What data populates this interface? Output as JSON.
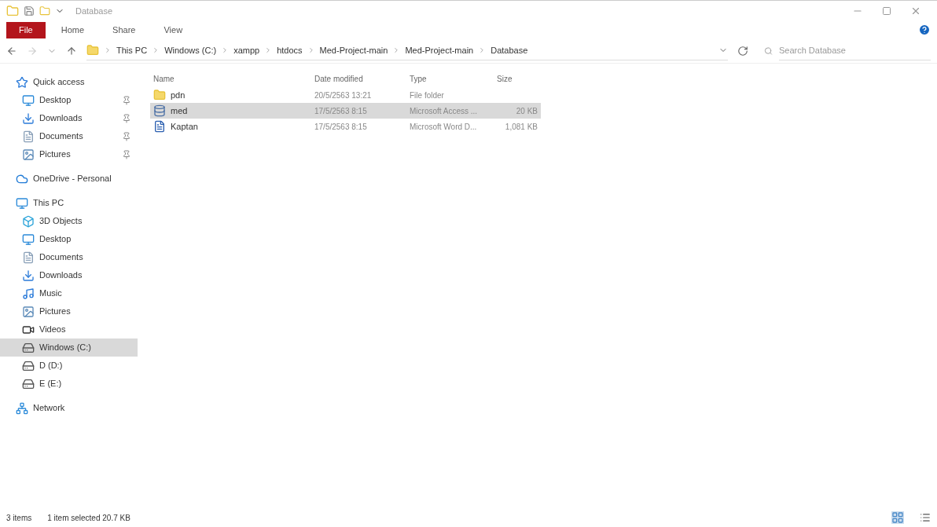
{
  "window": {
    "title": "Database"
  },
  "ribbon_tabs": [
    {
      "label": "File",
      "selected": true
    },
    {
      "label": "Home",
      "selected": false
    },
    {
      "label": "Share",
      "selected": false
    },
    {
      "label": "View",
      "selected": false
    }
  ],
  "breadcrumb": [
    "This PC",
    "Windows (C:)",
    "xampp",
    "htdocs",
    "Med-Project-main",
    "Med-Project-main",
    "Database"
  ],
  "search": {
    "placeholder": "Search Database"
  },
  "sidebar": [
    {
      "label": "Quick access",
      "selected": false,
      "children": [
        {
          "label": "Desktop",
          "selected": false,
          "pinned": true
        },
        {
          "label": "Downloads",
          "selected": false,
          "pinned": true
        },
        {
          "label": "Documents",
          "selected": false,
          "pinned": true
        },
        {
          "label": "Pictures",
          "selected": false,
          "pinned": true
        }
      ]
    },
    {
      "label": "OneDrive - Personal",
      "selected": false
    },
    {
      "label": "This PC",
      "selected": false,
      "children": [
        {
          "label": "3D Objects",
          "selected": false,
          "pinned": false
        },
        {
          "label": "Desktop",
          "selected": false,
          "pinned": false
        },
        {
          "label": "Documents",
          "selected": false,
          "pinned": false
        },
        {
          "label": "Downloads",
          "selected": false,
          "pinned": false
        },
        {
          "label": "Music",
          "selected": false,
          "pinned": false
        },
        {
          "label": "Pictures",
          "selected": false,
          "pinned": false
        },
        {
          "label": "Videos",
          "selected": false,
          "pinned": false
        },
        {
          "label": "Windows (C:)",
          "selected": true,
          "pinned": false
        },
        {
          "label": "D (D:)",
          "selected": false,
          "pinned": false
        },
        {
          "label": "E (E:)",
          "selected": false,
          "pinned": false
        }
      ]
    },
    {
      "label": "Network",
      "selected": false
    }
  ],
  "table": {
    "columns": [
      "Name",
      "Date modified",
      "Type",
      "Size"
    ],
    "rows": [
      {
        "kind": "folder",
        "name": "pdn",
        "date": "20/5/2563 13:21",
        "type": "File folder",
        "selected": false
      },
      {
        "kind": "access",
        "name": "med",
        "date": "17/5/2563 8:15",
        "type": "Microsoft Access ...",
        "size": "20 KB",
        "selected": true
      },
      {
        "kind": "word",
        "name": "Kaptan",
        "date": "17/5/2563 8:15",
        "type": "Microsoft Word D...",
        "size": "1,081 KB",
        "selected": false
      }
    ]
  },
  "status_bar": {
    "items": "3 items",
    "selection": "1 item selected 20.7 KB"
  }
}
